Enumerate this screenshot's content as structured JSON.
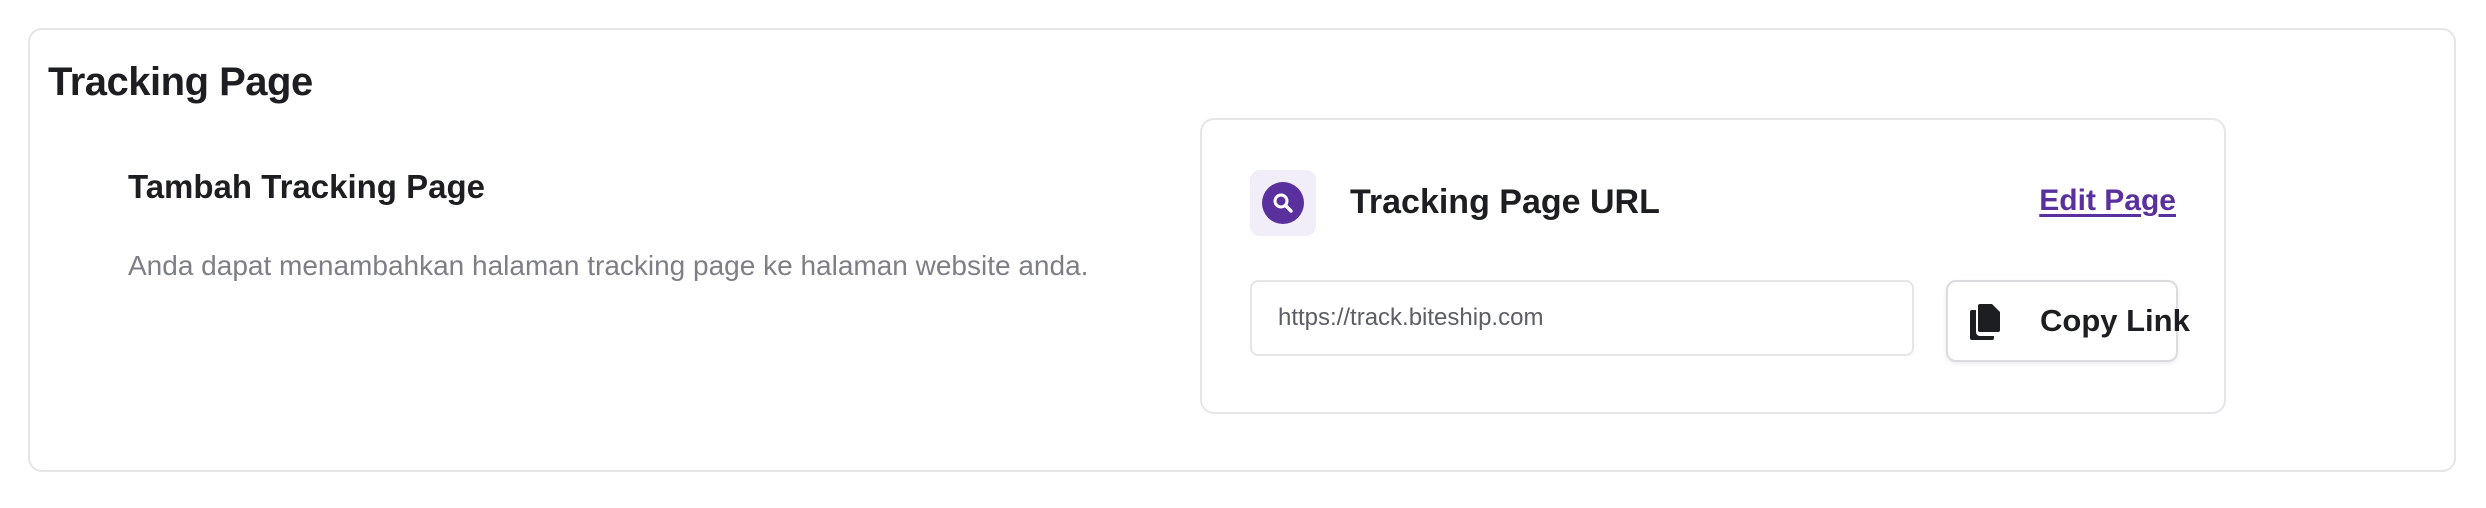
{
  "page": {
    "title": "Tracking Page"
  },
  "section": {
    "title": "Tambah Tracking Page",
    "description": "Anda dapat menambahkan halaman tracking page ke halaman website anda."
  },
  "panel": {
    "icon": "search-icon",
    "title": "Tracking Page URL",
    "edit_link": "Edit Page",
    "url_value": "https://track.biteship.com",
    "copy_button": "Copy Link",
    "copy_icon": "copy-icon"
  },
  "colors": {
    "accent": "#5a2f9e",
    "icon_tile_bg": "#f1eef9",
    "muted_text": "#7e7f86",
    "border": "#e6e6e9"
  }
}
